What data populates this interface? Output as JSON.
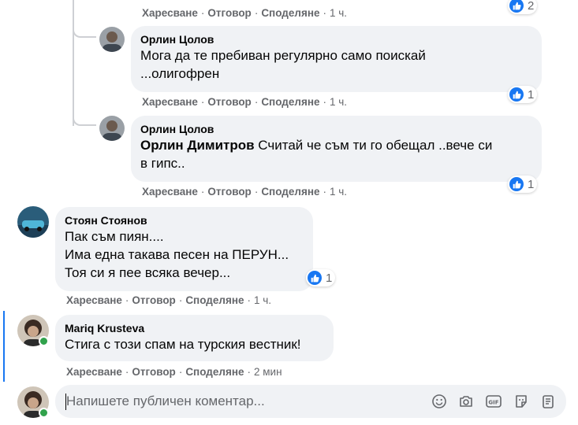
{
  "actions": {
    "like": "Харесване",
    "reply": "Отговор",
    "share": "Споделяне",
    "separator": "·"
  },
  "comments": [
    {
      "time": "1 ч.",
      "reactions": "2"
    },
    {
      "author": "Орлин Цолов",
      "text_lines": [
        "Мога да те пребиван регулярно само поискай",
        "...олигофрен"
      ],
      "time": "1 ч.",
      "reactions": "1"
    },
    {
      "author": "Орлин Цолов",
      "mention": "Орлин Димитров",
      "text_lines": [
        " Считай че съм ти го обещал ..вече си",
        "в гипс.."
      ],
      "time": "1 ч.",
      "reactions": "1"
    },
    {
      "author": "Стоян Стоянов",
      "text_lines": [
        "Пак съм пиян....",
        "Има една такава песен на ПЕРУН...",
        "Тоя си я пее всяка вечер..."
      ],
      "time": "1 ч.",
      "reactions": "1"
    },
    {
      "author": "Mariq Krusteva",
      "text_lines": [
        "Стига с този спам на турския вестник!"
      ],
      "time": "2 мин"
    }
  ],
  "composer": {
    "placeholder": "Напишете публичен коментар..."
  },
  "icons": {
    "like": "like-icon",
    "emoji": "emoji-icon",
    "camera": "camera-icon",
    "gif": "gif-icon",
    "sticker": "sticker-icon",
    "attachment": "attachment-icon"
  },
  "colors": {
    "accent": "#1877f2",
    "bubble": "#f0f2f5",
    "secondary_text": "#65676b",
    "online": "#31a24c"
  }
}
